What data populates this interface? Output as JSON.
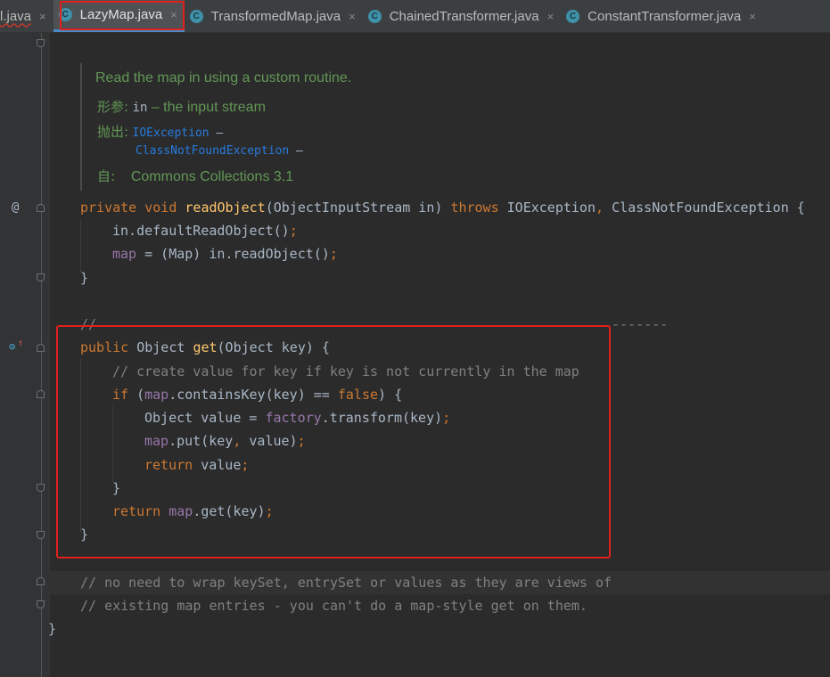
{
  "tabs": [
    {
      "label": "l.java",
      "icon": "class-icon",
      "active": false
    },
    {
      "label": "LazyMap.java",
      "icon": "class-icon",
      "active": true
    },
    {
      "label": "TransformedMap.java",
      "icon": "class-icon",
      "active": false
    },
    {
      "label": "ChainedTransformer.java",
      "icon": "class-icon",
      "active": false
    },
    {
      "label": "ConstantTransformer.java",
      "icon": "class-icon",
      "active": false
    }
  ],
  "tab_icon_letter": "C",
  "tab_close_glyph": "×",
  "doc": {
    "summary": "Read the map in using a custom routine.",
    "param_tag": "形参:",
    "param_name": "in",
    "param_desc": " – the input stream",
    "throws_tag": "抛出:",
    "throws1": "IOException",
    "throws2": "ClassNotFoundException",
    "dash": " –",
    "since_tag": "自:",
    "since_value": "Commons Collections 3.1"
  },
  "code": {
    "l1_kw": "private void ",
    "l1_fn": "readObject",
    "l1_a": "(ObjectInputStream in) ",
    "l1_kw2": "throws ",
    "l1_b": "IOException",
    "l1_comma": ", ",
    "l1_c": "ClassNotFoundException {",
    "l2_a": "in.defaultReadObject()",
    "l2_semi": ";",
    "l3_fld": "map",
    "l3_a": " = (Map) in.readObject()",
    "l3_semi": ";",
    "l4": "}",
    "l5": "//",
    "l5b": "-------",
    "l6_kw": "public ",
    "l6_a": "Object ",
    "l6_fn": "get",
    "l6_b": "(Object key) {",
    "l7": "// create value for key if key is not currently in the map",
    "l8_kw": "if ",
    "l8_a": "(",
    "l8_fld": "map",
    "l8_b": ".containsKey(key) == ",
    "l8_kw2": "false",
    "l8_c": ") {",
    "l9_a": "Object value = ",
    "l9_fld": "factory",
    "l9_b": ".transform(key)",
    "l9_semi": ";",
    "l10_fld": "map",
    "l10_a": ".put(key",
    "l10_comma": ", ",
    "l10_b": "value)",
    "l10_semi": ";",
    "l11_kw": "return ",
    "l11_a": "value",
    "l11_semi": ";",
    "l12": "}",
    "l13_kw": "return ",
    "l13_fld": "map",
    "l13_a": ".get(key)",
    "l13_semi": ";",
    "l14": "}",
    "l15": "// no need to wrap keySet, entrySet or values as they are views of",
    "l16": "// existing map entries - you can't do a map-style get on them.",
    "l17": "}"
  },
  "gutter": {
    "override_marker": "@",
    "implements_marker": "⊙",
    "implements_arrow": "↑"
  },
  "colors": {
    "highlight": "#e0201b",
    "keyword": "#cc7832",
    "function": "#ffc66d",
    "field": "#9876aa",
    "comment": "#808080",
    "doc": "#629755"
  }
}
